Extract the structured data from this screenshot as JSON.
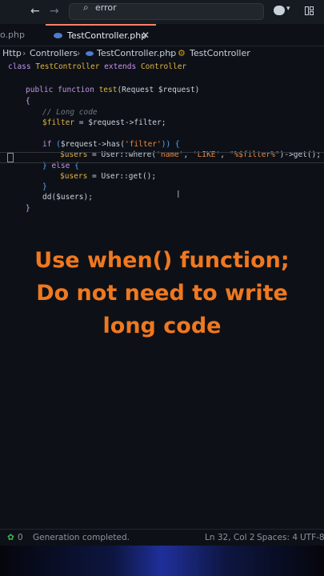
{
  "titlebar": {
    "back_icon": "←",
    "forward_icon": "→",
    "search_icon": "⌕",
    "search_text": "error",
    "copilot_caret": "▾",
    "more_icon": "⋮"
  },
  "tabs": [
    {
      "label": "o.php"
    },
    {
      "label": "TestController.php",
      "close": "✕"
    }
  ],
  "breadcrumb": {
    "items": [
      "Http",
      "Controllers",
      "TestController.php",
      "TestController"
    ],
    "sep": "›",
    "class_icon": "⚙"
  },
  "code": {
    "l1": {
      "kw": "class",
      "name": "TestController",
      "ext": "extends",
      "base": "Controller"
    },
    "l2": {
      "mod": "public",
      "fn": "function",
      "name": "test",
      "args": "(Request $request)"
    },
    "l3": "{",
    "l4": "// Long code",
    "l5": {
      "var": "$filter",
      "rest": " = $request->filter;"
    },
    "l6": {
      "kw": "if",
      "open": " (",
      "cond": "$request->has(",
      "str": "'filter'",
      "close": ")) {"
    },
    "l7": {
      "var": "$users",
      "mid": " = User::where(",
      "s1": "'name'",
      "c1": ", ",
      "s2": "'LIKE'",
      "c2": ", ",
      "s3": "\"%$filter%\"",
      "end": ")->get();"
    },
    "l8": {
      "close": "} ",
      "kw": "else",
      "open": " {"
    },
    "l9": {
      "var": "$users",
      "rest": " = User::get();"
    },
    "l10": "}",
    "l11": "dd($users);",
    "l12": "}",
    "l13": "}"
  },
  "caption": {
    "line1": "Use when() function;",
    "line2": "Do not need to write",
    "line3": "long code"
  },
  "status": {
    "errors_icon": "✿",
    "errors": "0",
    "message": "Generation completed.",
    "position": "Ln 32, Col 2",
    "spaces": "Spaces: 4",
    "encoding": "UTF-8"
  }
}
